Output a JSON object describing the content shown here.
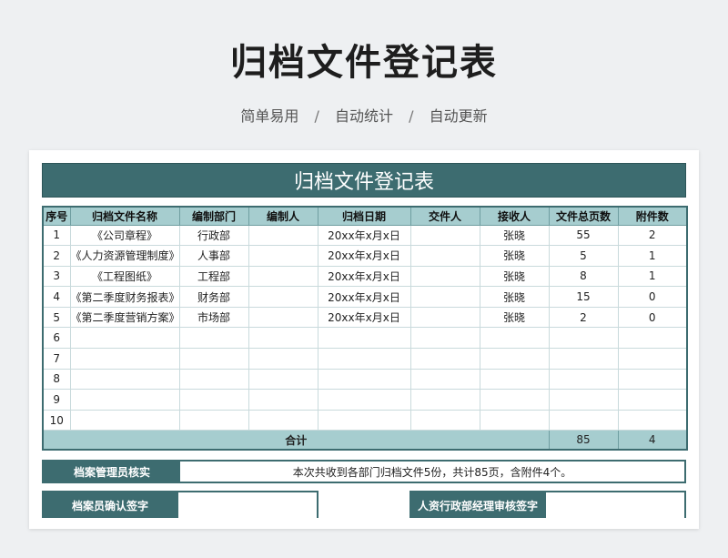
{
  "page": {
    "title": "归档文件登记表",
    "subtitle": {
      "item1": "简单易用",
      "item2": "自动统计",
      "item3": "自动更新",
      "separator": "/"
    }
  },
  "sheet": {
    "title": "归档文件登记表",
    "headers": [
      "序号",
      "归档文件名称",
      "编制部门",
      "编制人",
      "归档日期",
      "交件人",
      "接收人",
      "文件总页数",
      "附件数"
    ],
    "rows": [
      {
        "no": "1",
        "name": "《公司章程》",
        "dept": "行政部",
        "author": "",
        "date": "20xx年x月x日",
        "submitter": "",
        "receiver": "张晓",
        "pages": "55",
        "attachments": "2"
      },
      {
        "no": "2",
        "name": "《人力资源管理制度》",
        "dept": "人事部",
        "author": "",
        "date": "20xx年x月x日",
        "submitter": "",
        "receiver": "张晓",
        "pages": "5",
        "attachments": "1"
      },
      {
        "no": "3",
        "name": "《工程图纸》",
        "dept": "工程部",
        "author": "",
        "date": "20xx年x月x日",
        "submitter": "",
        "receiver": "张晓",
        "pages": "8",
        "attachments": "1"
      },
      {
        "no": "4",
        "name": "《第二季度财务报表》",
        "dept": "财务部",
        "author": "",
        "date": "20xx年x月x日",
        "submitter": "",
        "receiver": "张晓",
        "pages": "15",
        "attachments": "0"
      },
      {
        "no": "5",
        "name": "《第二季度营销方案》",
        "dept": "市场部",
        "author": "",
        "date": "20xx年x月x日",
        "submitter": "",
        "receiver": "张晓",
        "pages": "2",
        "attachments": "0"
      },
      {
        "no": "6",
        "name": "",
        "dept": "",
        "author": "",
        "date": "",
        "submitter": "",
        "receiver": "",
        "pages": "",
        "attachments": ""
      },
      {
        "no": "7",
        "name": "",
        "dept": "",
        "author": "",
        "date": "",
        "submitter": "",
        "receiver": "",
        "pages": "",
        "attachments": ""
      },
      {
        "no": "8",
        "name": "",
        "dept": "",
        "author": "",
        "date": "",
        "submitter": "",
        "receiver": "",
        "pages": "",
        "attachments": ""
      },
      {
        "no": "9",
        "name": "",
        "dept": "",
        "author": "",
        "date": "",
        "submitter": "",
        "receiver": "",
        "pages": "",
        "attachments": ""
      },
      {
        "no": "10",
        "name": "",
        "dept": "",
        "author": "",
        "date": "",
        "submitter": "",
        "receiver": "",
        "pages": "",
        "attachments": ""
      }
    ],
    "total": {
      "label": "合计",
      "pages": "85",
      "attachments": "4"
    },
    "verification": {
      "label": "档案管理员核实",
      "text": "本次共收到各部门归档文件5份，共计85页，含附件4个。"
    },
    "signatures": {
      "archivist_label": "档案员确认签字",
      "manager_label": "人资行政部经理审核签字"
    }
  },
  "colors": {
    "header_dark": "#3d6c70",
    "header_light": "#a6cdcf"
  }
}
